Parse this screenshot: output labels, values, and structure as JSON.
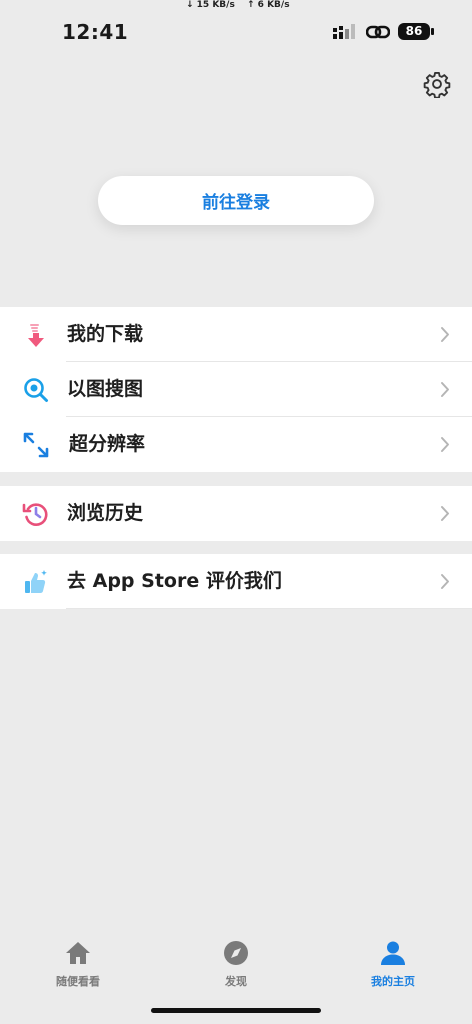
{
  "status": {
    "net_down": "↓ 15 KB/s",
    "net_up": "↑ 6 KB/s",
    "time": "12:41",
    "battery": "86"
  },
  "login_label": "前往登录",
  "menu": {
    "download": "我的下载",
    "image_search": "以图搜图",
    "super_resolution": "超分辨率",
    "history": "浏览历史",
    "rate": "去 App Store 评价我们"
  },
  "tabs": {
    "random": "随便看看",
    "discover": "发现",
    "mine": "我的主页"
  },
  "colors": {
    "accent": "#1a7fe0",
    "download_icon": "#f05a7e",
    "search_icon": "#1aa0e8",
    "resolution_icon": "#1a7fe0",
    "history_icon": "#e8507a",
    "rate_icon": "#4fb7f0"
  }
}
